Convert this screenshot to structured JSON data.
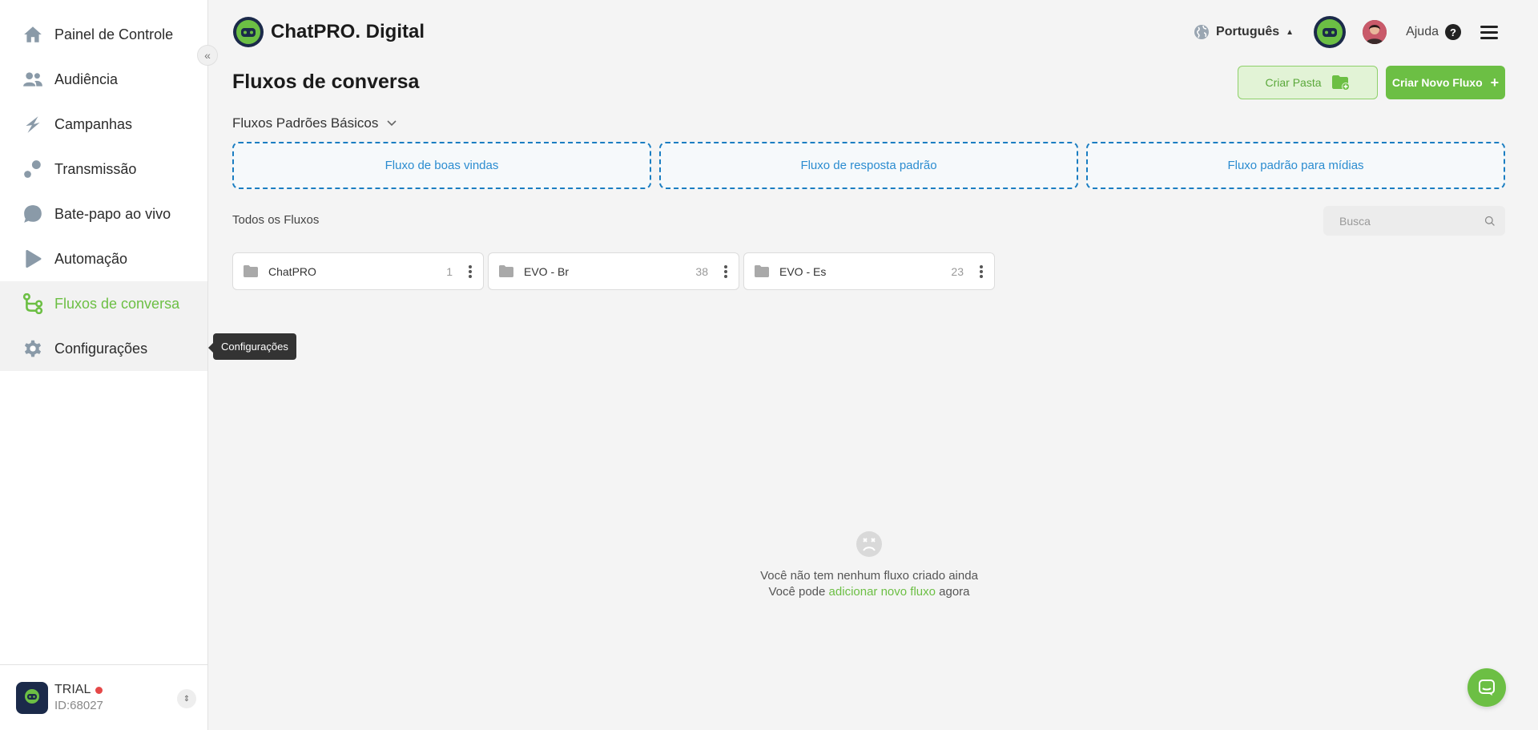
{
  "sidebar": {
    "items": [
      {
        "label": "Painel de Controle",
        "icon": "home-icon"
      },
      {
        "label": "Audiência",
        "icon": "users-icon"
      },
      {
        "label": "Campanhas",
        "icon": "campaign-icon"
      },
      {
        "label": "Transmissão",
        "icon": "broadcast-icon"
      },
      {
        "label": "Bate-papo ao vivo",
        "icon": "chat-bubble-icon"
      },
      {
        "label": "Automação",
        "icon": "automation-icon"
      },
      {
        "label": "Fluxos de conversa",
        "icon": "flow-icon"
      },
      {
        "label": "Configurações",
        "icon": "gear-icon"
      }
    ],
    "active_item": "Fluxos de conversa",
    "tooltip": "Configurações",
    "account": {
      "plan": "TRIAL",
      "id": "ID:68027"
    }
  },
  "header": {
    "brand": "ChatPRO. Digital",
    "language": "Português",
    "help": "Ajuda"
  },
  "main": {
    "title": "Fluxos de conversa",
    "create_folder": "Criar Pasta",
    "create_flow": "Criar Novo Fluxo",
    "basic_section": "Fluxos Padrões Básicos",
    "basic_flows": [
      "Fluxo de boas vindas",
      "Fluxo de resposta padrão",
      "Fluxo padrão para mídias"
    ],
    "all_title": "Todos os Fluxos",
    "search_placeholder": "Busca",
    "folders": [
      {
        "name": "ChatPRO",
        "count": "1"
      },
      {
        "name": "EVO - Br",
        "count": "38"
      },
      {
        "name": "EVO - Es",
        "count": "23"
      }
    ],
    "empty": {
      "line1": "Você não tem nenhum fluxo criado ainda",
      "line2_pre": "Você pode",
      "line2_link": "adicionar novo fluxo",
      "line2_post": "agora"
    }
  },
  "colors": {
    "accent": "#6cbf44",
    "dashed_border": "#1b7ec2",
    "link_blue": "#2b8cd0",
    "tooltip_bg": "#333333"
  }
}
